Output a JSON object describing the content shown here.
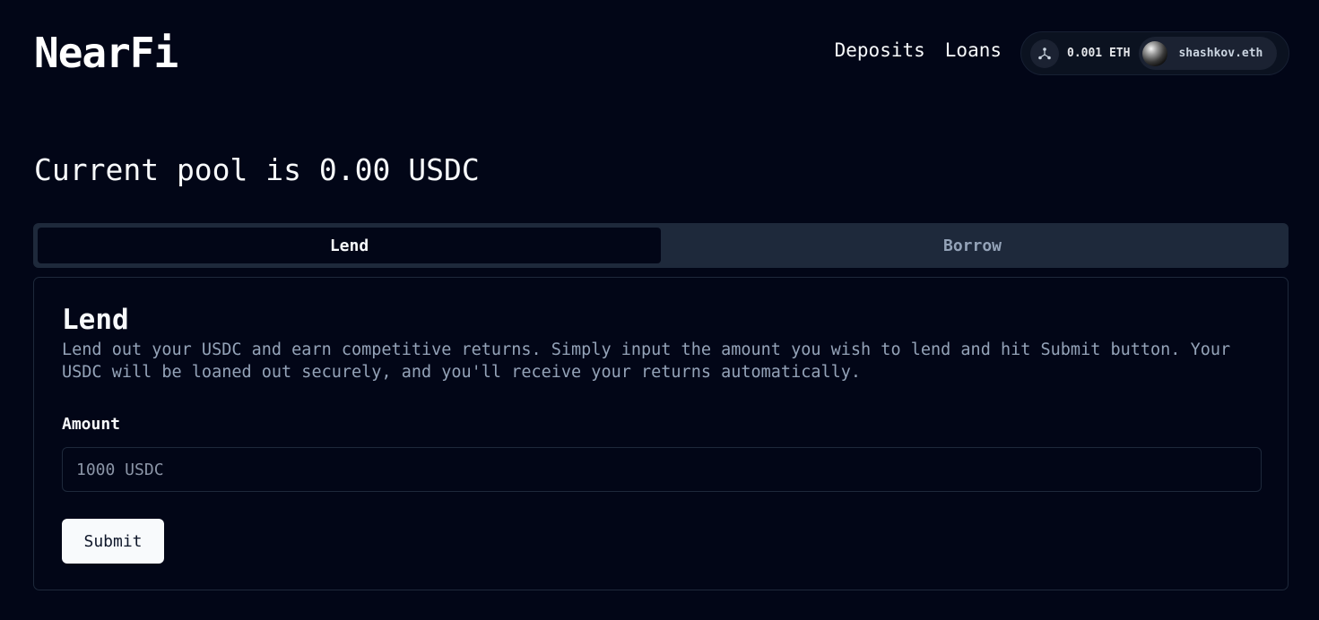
{
  "header": {
    "logo": "NearFi",
    "nav": [
      {
        "label": "Deposits"
      },
      {
        "label": "Loans"
      }
    ],
    "wallet": {
      "chain_icon": "network-icon",
      "balance": "0.001 ETH",
      "account_name": "shashkov.eth",
      "avatar_icon": "avatar-sphere"
    }
  },
  "pool": {
    "title": "Current pool is 0.00 USDC"
  },
  "tabs": [
    {
      "label": "Lend",
      "active": true
    },
    {
      "label": "Borrow",
      "active": false
    }
  ],
  "lend_card": {
    "title": "Lend",
    "description": "Lend out your USDC and earn competitive returns. Simply input the amount you wish to lend and hit Submit button. Your USDC will be loaned out securely, and you'll receive your returns automatically.",
    "amount_label": "Amount",
    "amount_value": "",
    "amount_placeholder": "1000 USDC",
    "submit_label": "Submit"
  },
  "colors": {
    "background": "#020617",
    "surface": "#1e293b",
    "text": "#f8fafc",
    "muted": "#94a3b8"
  }
}
